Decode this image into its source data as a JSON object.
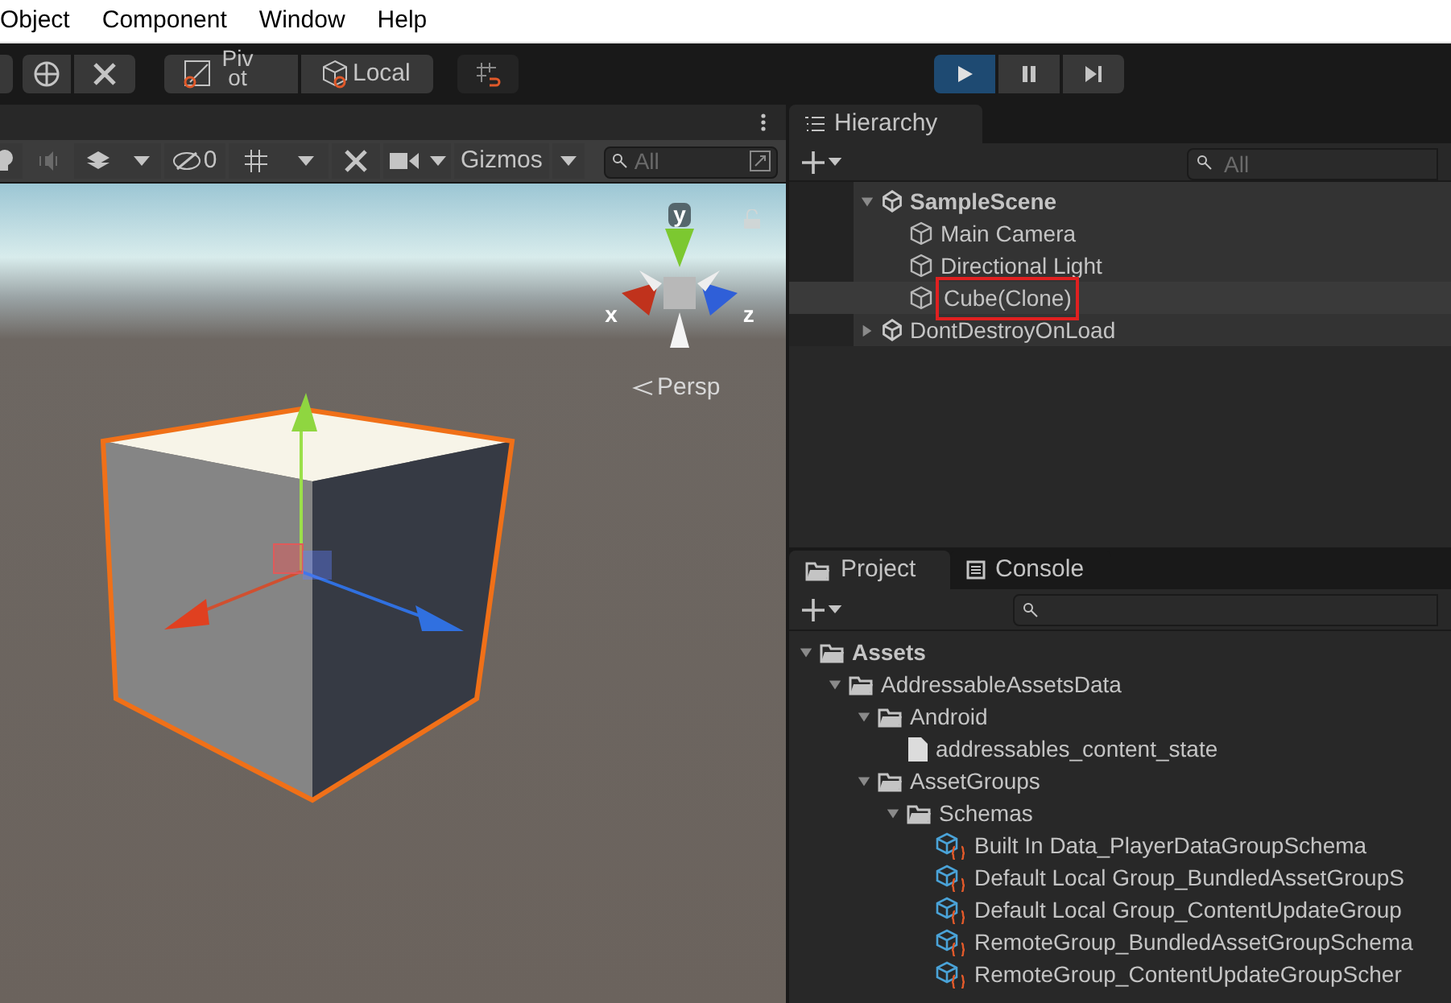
{
  "menu": [
    "Object",
    "Component",
    "Window",
    "Help"
  ],
  "toolbar": {
    "pivot": "Pivot",
    "local": "Local",
    "playback": [
      {
        "kind": "play",
        "selected": true
      },
      {
        "kind": "pause",
        "selected": false
      },
      {
        "kind": "step",
        "selected": false
      }
    ]
  },
  "scene": {
    "hidden_count": "0",
    "gizmos": "Gizmos",
    "search": {
      "placeholder": "All"
    },
    "axes": [
      "x",
      "y",
      "z"
    ],
    "projection": "Persp"
  },
  "hierarchy": {
    "tab": "Hierarchy",
    "search": {
      "placeholder": "All"
    },
    "tree": [
      {
        "label": "SampleScene",
        "kind": "scene",
        "expanded": true,
        "selected": false,
        "children": [
          {
            "label": "Main Camera",
            "kind": "object",
            "selected": false
          },
          {
            "label": "Directional Light",
            "kind": "object",
            "selected": false
          },
          {
            "label": "Cube(Clone)",
            "kind": "object",
            "selected": true
          }
        ]
      },
      {
        "label": "DontDestroyOnLoad",
        "kind": "scene",
        "expanded": false,
        "selected": false
      }
    ]
  },
  "project": {
    "tabs": [
      {
        "label": "Project",
        "kind": "folder",
        "selected": true
      },
      {
        "label": "Console",
        "kind": "console",
        "selected": false
      }
    ],
    "tree": [
      {
        "label": "Assets",
        "kind": "folder",
        "expanded": true,
        "children": [
          {
            "label": "AddressableAssetsData",
            "kind": "folder",
            "expanded": true,
            "children": [
              {
                "label": "Android",
                "kind": "folder",
                "expanded": true,
                "children": [
                  {
                    "label": "addressables_content_state",
                    "kind": "file"
                  }
                ]
              },
              {
                "label": "AssetGroups",
                "kind": "folder",
                "expanded": true,
                "children": [
                  {
                    "label": "Schemas",
                    "kind": "folder",
                    "expanded": true,
                    "children": [
                      {
                        "label": "Built In Data_PlayerDataGroupSchema",
                        "kind": "schema"
                      },
                      {
                        "label": "Default Local Group_BundledAssetGroupS",
                        "kind": "schema"
                      },
                      {
                        "label": "Default Local Group_ContentUpdateGroup",
                        "kind": "schema"
                      },
                      {
                        "label": "RemoteGroup_BundledAssetGroupSchema",
                        "kind": "schema"
                      },
                      {
                        "label": "RemoteGroup_ContentUpdateGroupScher",
                        "kind": "schema"
                      }
                    ]
                  }
                ]
              }
            ]
          }
        ]
      }
    ]
  }
}
